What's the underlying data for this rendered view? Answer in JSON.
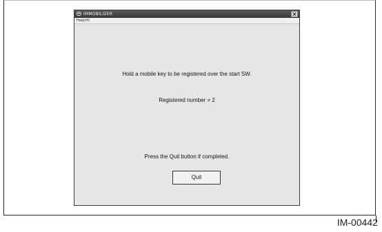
{
  "window": {
    "title": "IMMOBILIZER",
    "menu": {
      "help": "Help(H)"
    }
  },
  "content": {
    "instruction": "Hold a mobile key to be registered over the start SW.",
    "registered": "Registered number =  2",
    "press_quit": "Press the Quit button if completed.",
    "quit_label": "Quit"
  },
  "caption": "IM-00442"
}
